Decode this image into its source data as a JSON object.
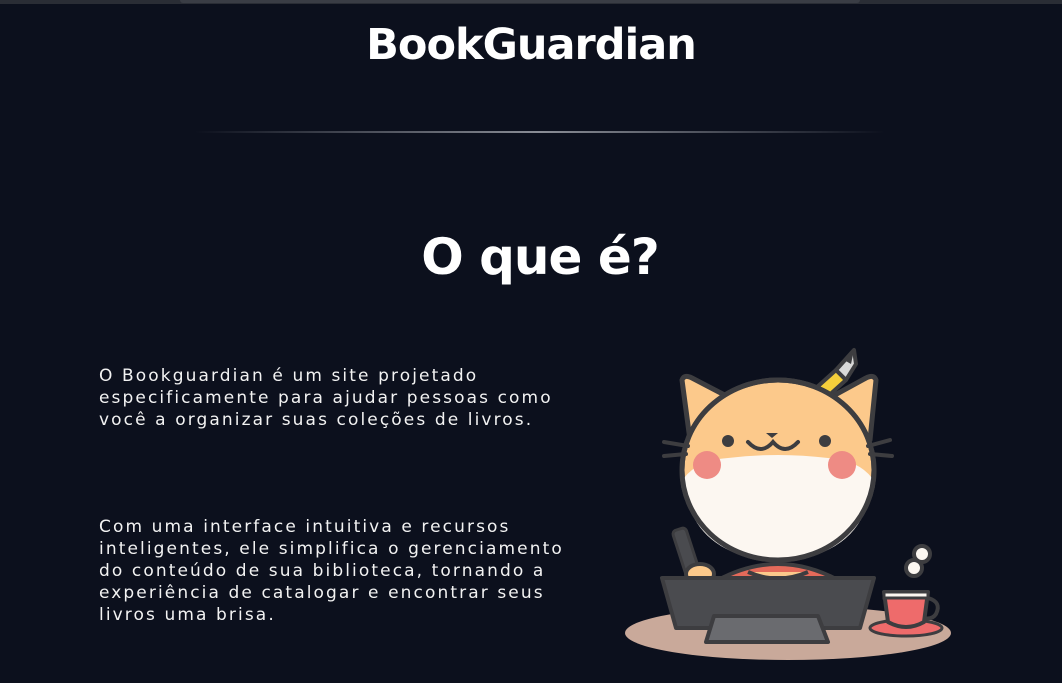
{
  "header": {
    "brand": "BookGuardian"
  },
  "about": {
    "title": "O que é?",
    "paragraphs": [
      "O Bookguardian é um site projetado especificamente para ajudar pessoas como você a organizar suas coleções de livros.",
      "Com uma interface intuitiva e recursos inteligentes, ele simplifica o gerenciamento do conteúdo de sua biblioteca, tornando a experiência de catalogar e encontrar seus livros uma brisa."
    ]
  },
  "colors": {
    "background": "#0c101d",
    "text": "#ffffff",
    "cat_fur": "#fcc98b",
    "cat_face": "#fcf7f1",
    "cheek": "#ee8b84",
    "cup": "#ee6b6b",
    "laptop": "#4a4b4f"
  }
}
